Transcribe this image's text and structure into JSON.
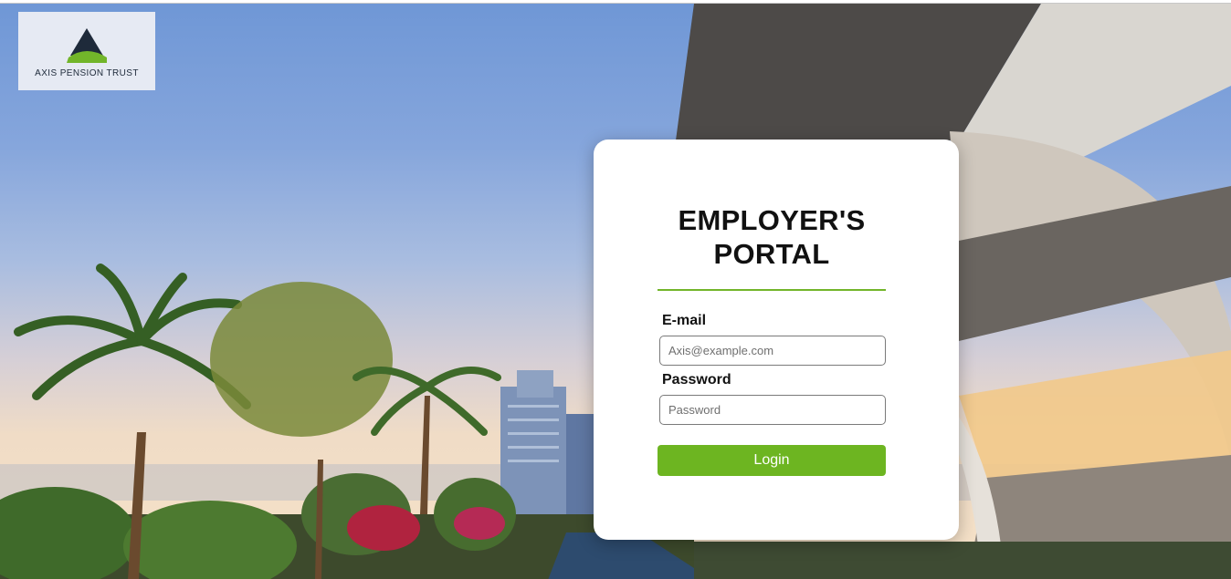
{
  "brand": {
    "name": "AXIS PENSION TRUST",
    "logo_icon": "axis-triangle-logo",
    "colors": {
      "green": "#72b52a",
      "navy": "#1e2a3a"
    }
  },
  "login": {
    "title_line1": "EMPLOYER'S",
    "title_line2": "PORTAL",
    "email_label": "E-mail",
    "email_placeholder": "Axis@example.com",
    "email_value": "",
    "password_label": "Password",
    "password_placeholder": "Password",
    "password_value": "",
    "login_button": "Login",
    "button_color": "#6db521"
  }
}
